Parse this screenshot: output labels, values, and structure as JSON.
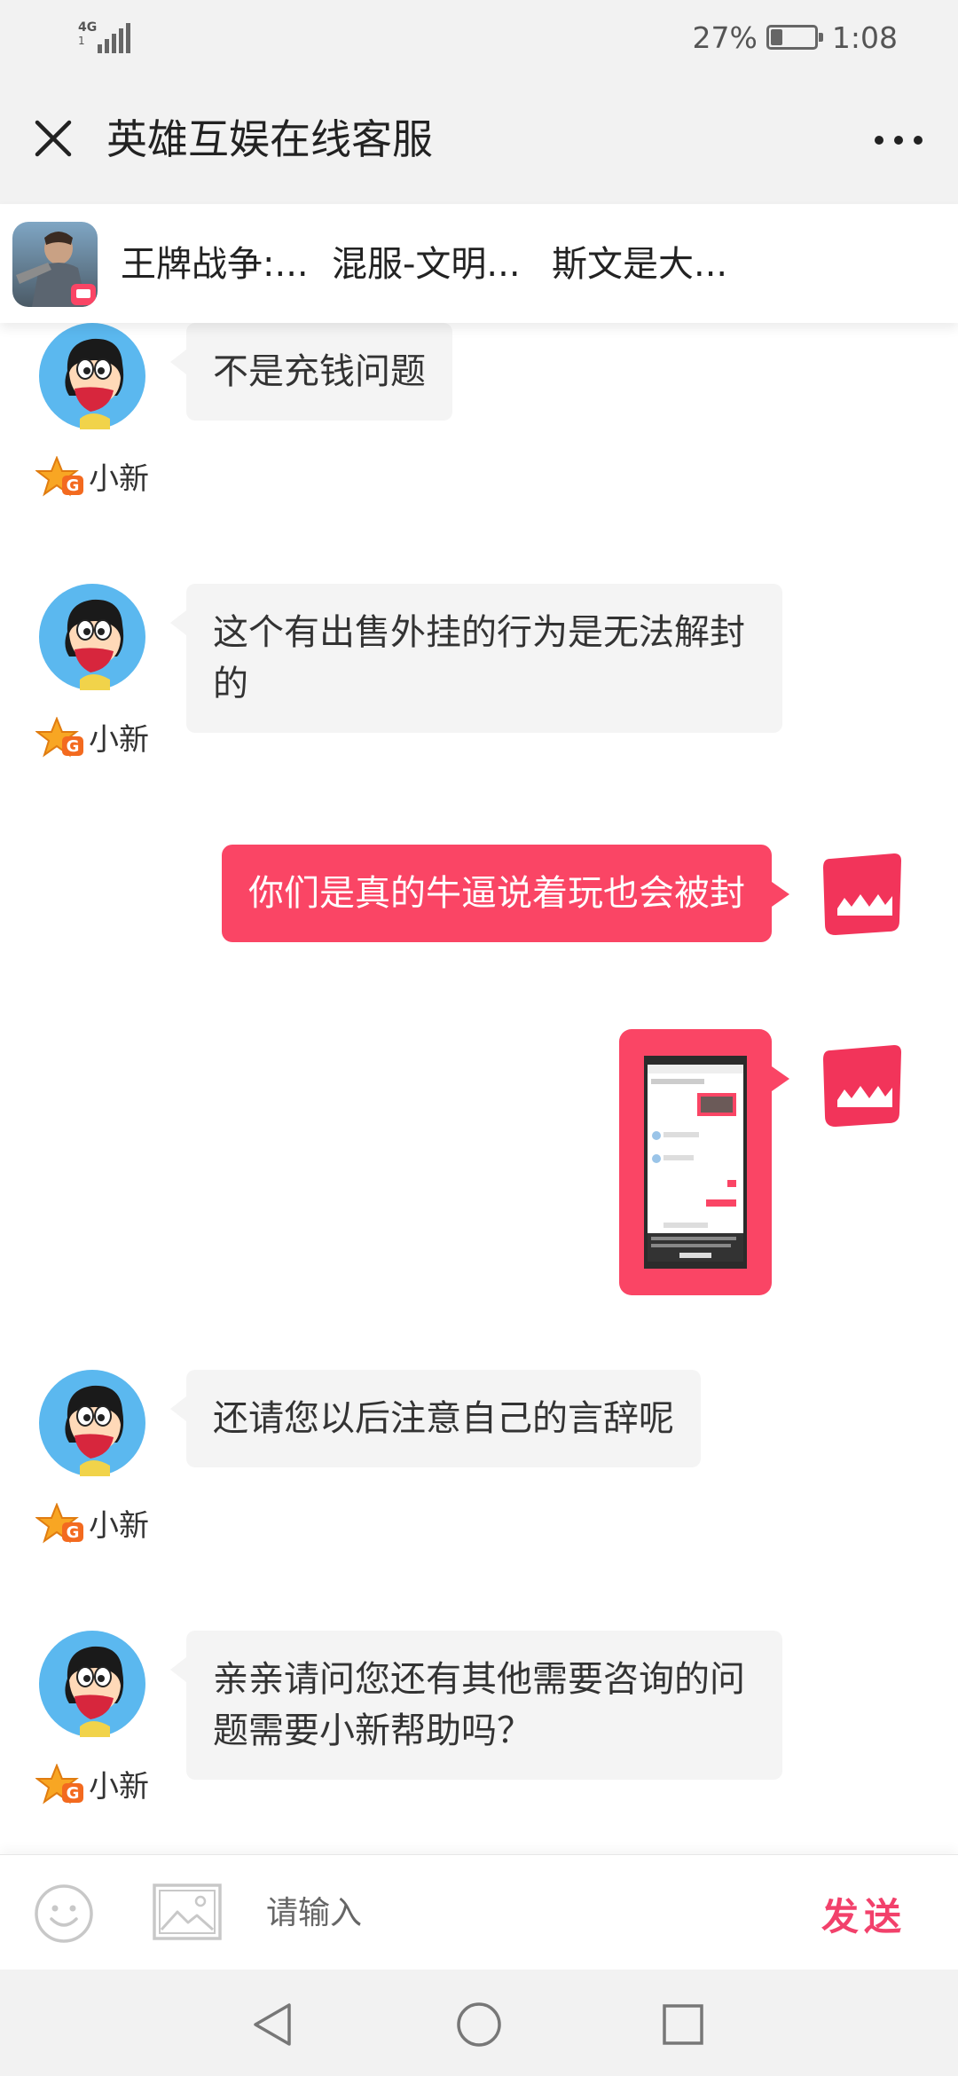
{
  "status_bar": {
    "network": "4G",
    "network_sub": "1",
    "battery_percent": "27%",
    "battery_level": 0.27,
    "time": "1:08"
  },
  "header": {
    "title": "英雄互娱在线客服"
  },
  "game_tabs": [
    {
      "label": "王牌战争:..."
    },
    {
      "label": "混服-文明..."
    },
    {
      "label": "斯文是大..."
    }
  ],
  "messages": [
    {
      "sender": "agent",
      "name": "小新",
      "text": "不是充钱问题"
    },
    {
      "sender": "agent",
      "name": "小新",
      "text": "这个有出售外挂的行为是无法解封的"
    },
    {
      "sender": "user",
      "text": "你们是真的牛逼说着玩也会被封"
    },
    {
      "sender": "user",
      "type": "image"
    },
    {
      "sender": "agent",
      "name": "小新",
      "text": "还请您以后注意自己的言辞呢"
    },
    {
      "sender": "agent",
      "name": "小新",
      "text": "亲亲请问您还有其他需要咨询的问题需要小新帮助吗？"
    }
  ],
  "input": {
    "placeholder": "请输入",
    "send_label": "发送"
  },
  "colors": {
    "accent": "#fa4565",
    "send": "#f2416b",
    "bar_bg": "#f2f2f2",
    "agent_bubble": "#f4f4f4"
  },
  "icons": {
    "close": "close-icon",
    "more": "more-icon",
    "emoji": "emoji-icon",
    "image": "image-icon",
    "back": "back-icon",
    "home": "home-icon",
    "recents": "recents-icon"
  }
}
